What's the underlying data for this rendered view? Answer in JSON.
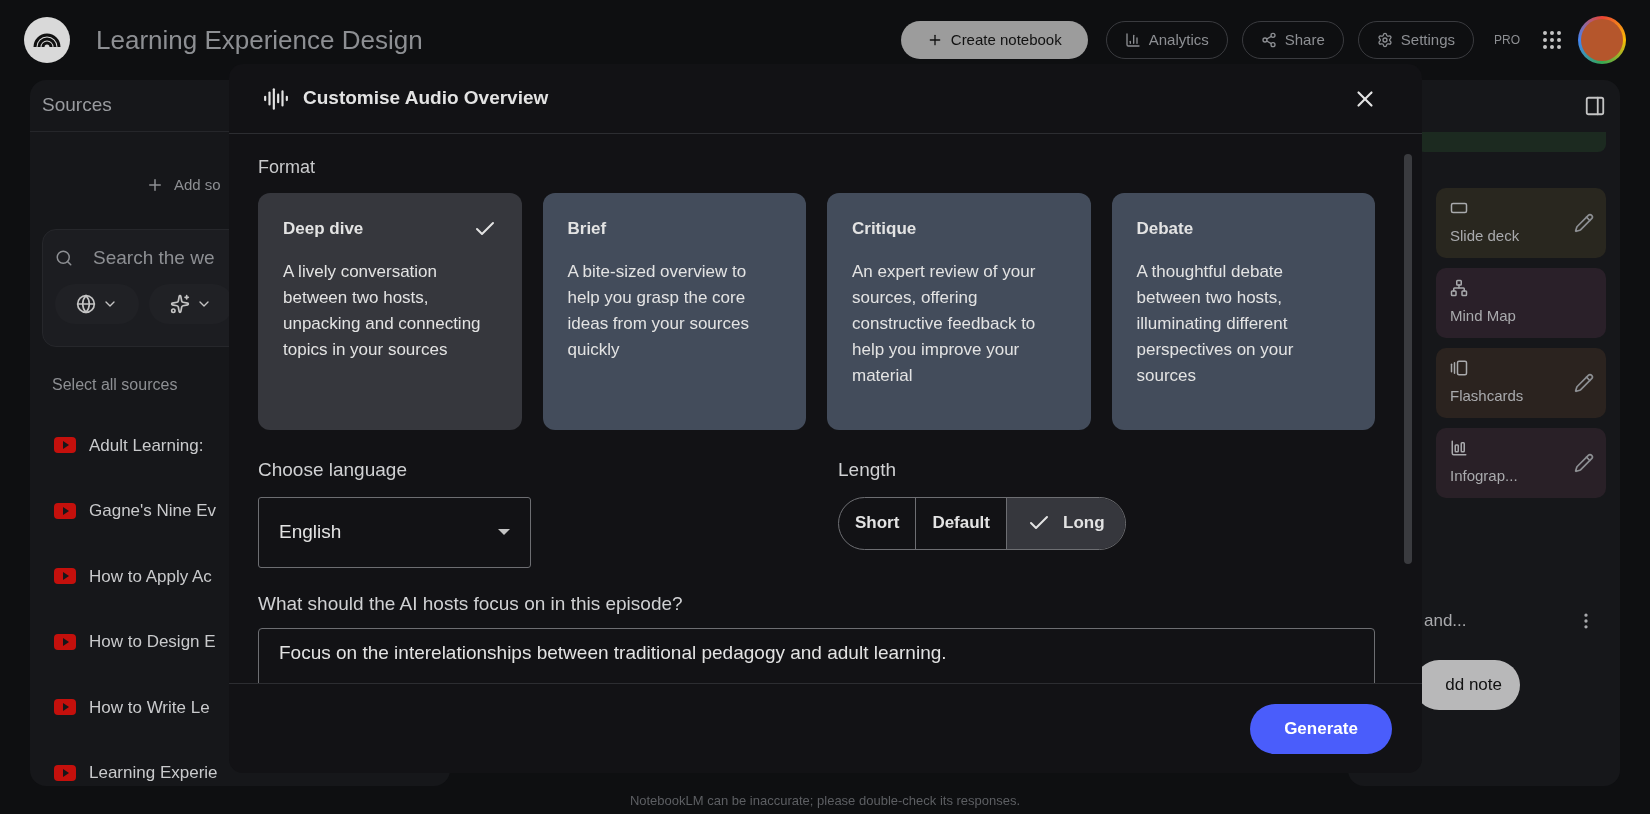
{
  "app": {
    "title": "Learning Experience Design",
    "pro_label": "PRO"
  },
  "header_buttons": [
    {
      "kind": "create",
      "label": "Create notebook"
    },
    {
      "kind": "analytics",
      "label": "Analytics"
    },
    {
      "kind": "share",
      "label": "Share"
    },
    {
      "kind": "settings",
      "label": "Settings"
    }
  ],
  "sources_panel": {
    "title": "Sources",
    "add_label": "Add so",
    "search_placeholder": "Search the we",
    "select_all": "Select all sources",
    "sources": [
      {
        "title": "Adult Learning:"
      },
      {
        "title": "Gagne's Nine Ev"
      },
      {
        "title": "How to Apply Ac"
      },
      {
        "title": "How to Design E"
      },
      {
        "title": "How to Write Le"
      },
      {
        "title": "Learning Experie"
      }
    ]
  },
  "studio_panel": {
    "items": [
      {
        "kind": "slides",
        "label": "Slide deck",
        "editable": true
      },
      {
        "kind": "mindmap",
        "label": "Mind Map",
        "editable": false
      },
      {
        "kind": "flashcards",
        "label": "Flashcards",
        "editable": true
      },
      {
        "kind": "infographic",
        "label": "Infograp...",
        "editable": true
      }
    ],
    "note_title": "and...",
    "add_note": "dd note"
  },
  "dialog": {
    "title": "Customise Audio Overview",
    "format_label": "Format",
    "formats": [
      {
        "title": "Deep dive",
        "description": "A lively conversation between two hosts, unpacking and connecting topics in your sources",
        "selected": true
      },
      {
        "title": "Brief",
        "description": "A bite-sized overview to help you grasp the core ideas from your sources quickly",
        "selected": false
      },
      {
        "title": "Critique",
        "description": "An expert review of your sources, offering constructive feedback to help you improve your material",
        "selected": false
      },
      {
        "title": "Debate",
        "description": "A thoughtful debate between two hosts, illuminating different perspectives on your sources",
        "selected": false
      }
    ],
    "language_label": "Choose language",
    "language_value": "English",
    "length_label": "Length",
    "lengths": [
      {
        "label": "Short",
        "selected": false
      },
      {
        "label": "Default",
        "selected": false
      },
      {
        "label": "Long",
        "selected": true
      }
    ],
    "focus_label": "What should the AI hosts focus on in this episode?",
    "focus_value": "Focus on the interelationships between traditional pedagogy and adult learning.",
    "generate_button": "Generate"
  },
  "disclaimer": "NotebookLM can be inaccurate; please double-check its responses."
}
